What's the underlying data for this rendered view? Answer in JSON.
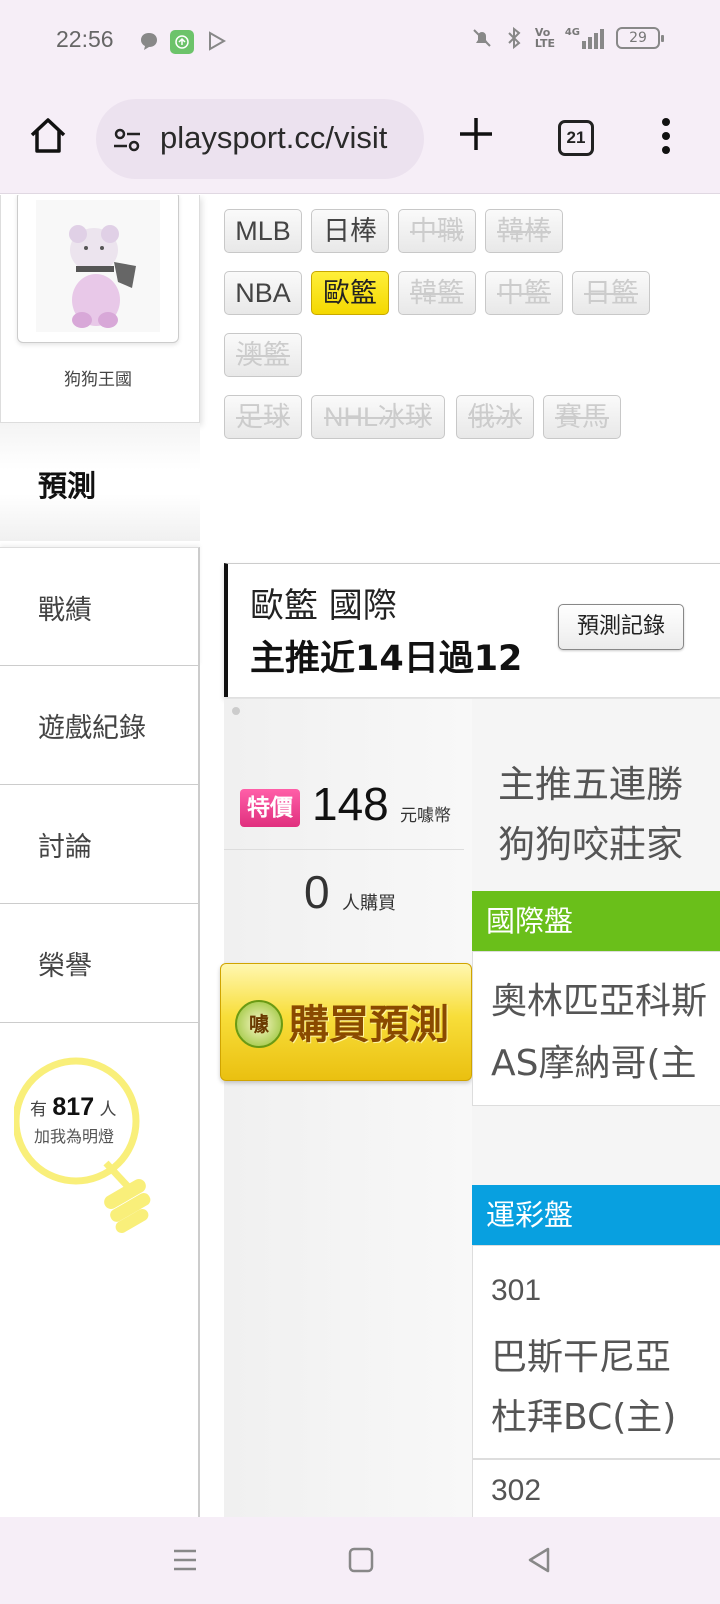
{
  "status_bar": {
    "time": "22:56",
    "network": "4G",
    "volte": "Vo LTE",
    "battery": "29"
  },
  "browser": {
    "url": "playsport.cc/visit",
    "tab_count": "21"
  },
  "profile": {
    "name": "狗狗王國"
  },
  "leagues": {
    "row1": [
      {
        "label": "MLB",
        "state": "normal"
      },
      {
        "label": "日棒",
        "state": "normal"
      },
      {
        "label": "中職",
        "state": "disabled"
      },
      {
        "label": "韓棒",
        "state": "disabled"
      }
    ],
    "row2": [
      {
        "label": "NBA",
        "state": "normal"
      },
      {
        "label": "歐籃",
        "state": "selected"
      },
      {
        "label": "韓籃",
        "state": "disabled"
      },
      {
        "label": "中籃",
        "state": "disabled"
      },
      {
        "label": "日籃",
        "state": "disabled"
      }
    ],
    "row3": [
      {
        "label": "澳籃",
        "state": "disabled"
      }
    ],
    "row4": [
      {
        "label": "足球",
        "state": "disabled"
      },
      {
        "label": "NHL冰球",
        "state": "disabled"
      },
      {
        "label": "俄冰",
        "state": "disabled"
      },
      {
        "label": "賽馬",
        "state": "disabled"
      }
    ]
  },
  "sidebar": {
    "active": "預測",
    "items": [
      {
        "label": "戰績"
      },
      {
        "label": "遊戲紀錄"
      },
      {
        "label": "討論"
      },
      {
        "label": "榮譽"
      }
    ]
  },
  "fans": {
    "prefix": "有",
    "count": "817",
    "suffix": "人",
    "caption": "加我為明燈"
  },
  "prediction": {
    "title": "歐籃 國際",
    "subtitle": "主推近14日過12",
    "record_button": "預測記錄"
  },
  "product": {
    "promo_tag": "特價",
    "price": "148",
    "price_unit": "元噱幣",
    "buyers": "0",
    "buyers_label": "人購買",
    "buy_button": "購買預測",
    "buy_icon": "噱",
    "headline_line1": "主推五連勝",
    "headline_line2": "狗狗咬莊家"
  },
  "intl_section": {
    "header": "國際盤",
    "line1": "奧林匹亞科斯",
    "line2": "AS摩納哥(主"
  },
  "lottery_section": {
    "header": "運彩盤",
    "number": "301",
    "line1": "巴斯干尼亞",
    "line2": "杜拜BC(主)",
    "next_number": "302"
  },
  "colors": {
    "green_header": "#6abf1a",
    "blue_header": "#08a0e0",
    "selected_chip": "#f4d800",
    "promo_pink": "#e0307e"
  }
}
